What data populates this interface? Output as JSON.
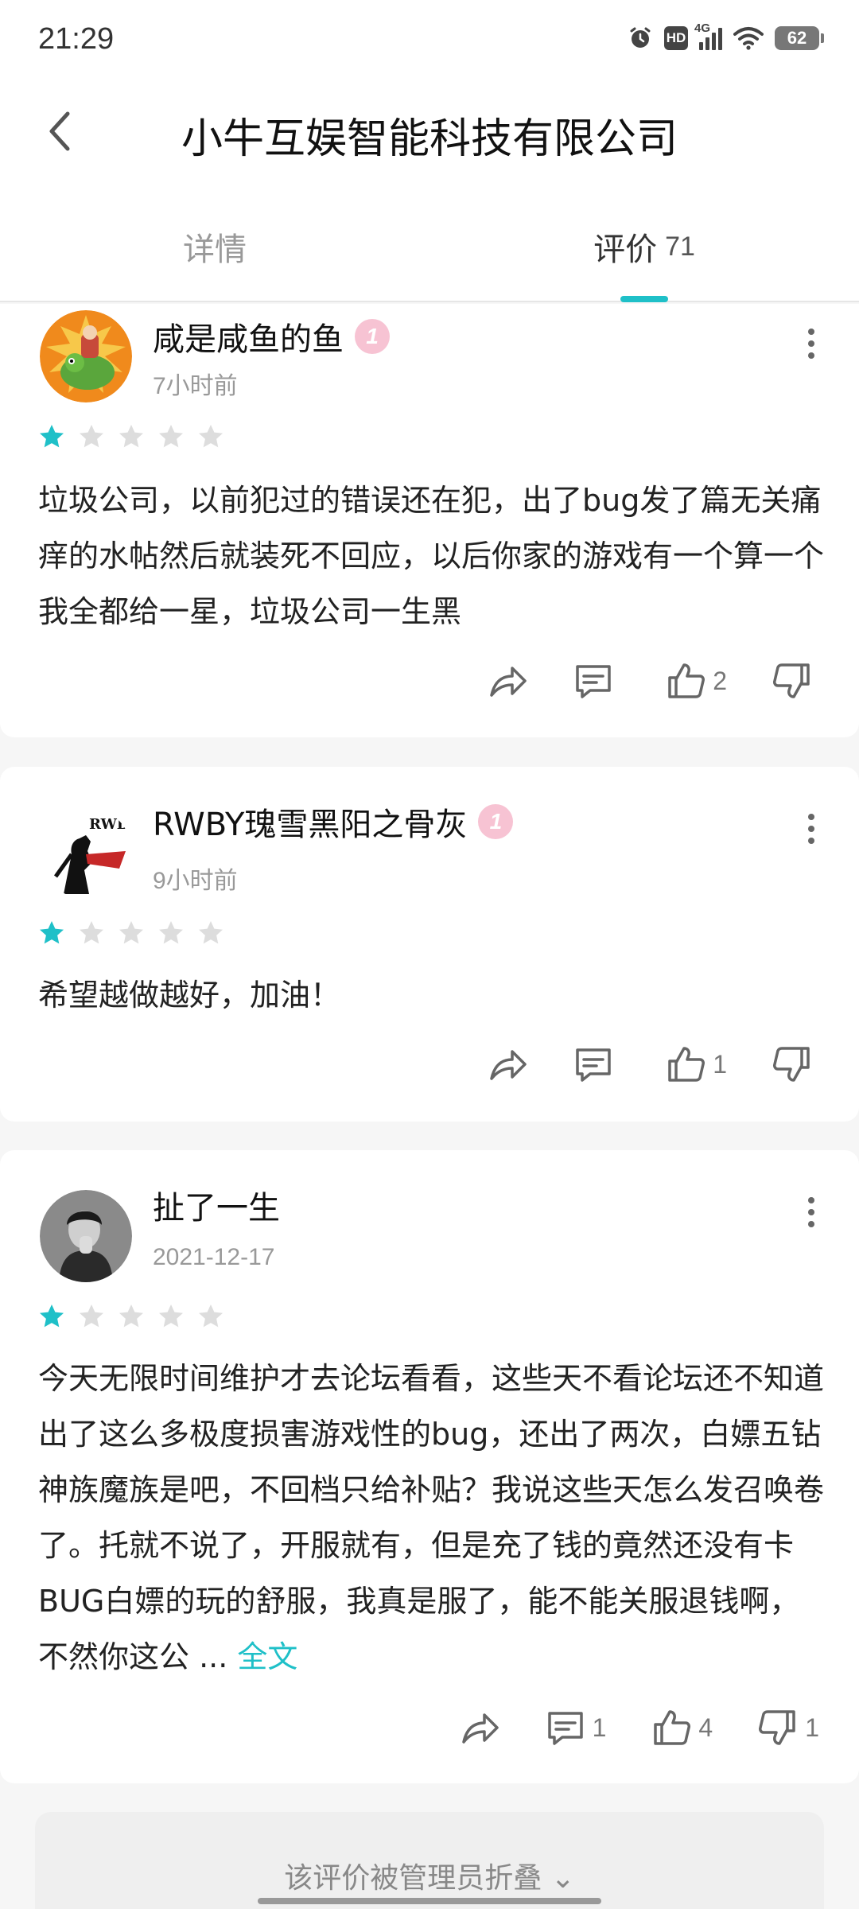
{
  "status_bar": {
    "time": "21:29",
    "hd": "HD",
    "network": "4G",
    "battery": "62"
  },
  "header": {
    "title": "小牛互娱智能科技有限公司"
  },
  "tabs": {
    "details": "详情",
    "reviews": "评价",
    "reviews_count": "71"
  },
  "reviews": [
    {
      "username": "咸是咸鱼的鱼",
      "level": "1",
      "time": "7小时前",
      "rating": 1,
      "max_rating": 5,
      "text": "垃圾公司，以前犯过的错误还在犯，出了bug发了篇无关痛痒的水帖然后就装死不回应，以后你家的游戏有一个算一个我全都给一星，垃圾公司一生黑",
      "likes": "2",
      "comments": "",
      "dislikes": ""
    },
    {
      "username": "RWBY瑰雪黑阳之骨灰",
      "level": "1",
      "time": "9小时前",
      "rating": 1,
      "max_rating": 5,
      "avatar_text": "RWBY",
      "text": "希望越做越好，加油！",
      "likes": "1",
      "comments": "",
      "dislikes": ""
    },
    {
      "username": "扯了一生",
      "level": "",
      "time": "2021-12-17",
      "rating": 1,
      "max_rating": 5,
      "text": "今天无限时间维护才去论坛看看，这些天不看论坛还不知道出了这么多极度损害游戏性的bug，还出了两次，白嫖五钻神族魔族是吧，不回档只给补贴？我说这些天怎么发召唤卷了。托就不说了，开服就有，但是充了钱的竟然还没有卡BUG白嫖的玩的舒服，我真是服了，能不能关服退钱啊，不然你这公 ... ",
      "more_label": "全文",
      "likes": "4",
      "comments": "1",
      "dislikes": "1"
    }
  ],
  "folded_notice": "该评价被管理员折叠 ⌄",
  "colors": {
    "accent": "#1fc0c8",
    "star_off": "#dddddd",
    "badge": "#f7c3d3"
  }
}
